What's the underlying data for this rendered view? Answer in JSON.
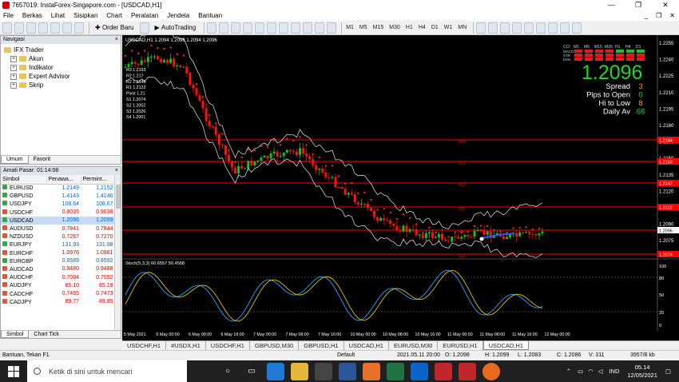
{
  "window": {
    "title": "7657019: InstaForex-Singapore.com - [USDCAD,H1]",
    "controls": [
      "—",
      "❐",
      "✕"
    ]
  },
  "menu": {
    "items": [
      "File",
      "Berkas",
      "Lihat",
      "Sisipkan",
      "Chart",
      "Peralatan",
      "Jendela",
      "Bantuan"
    ],
    "mdi": [
      "_",
      "❐",
      "✕"
    ]
  },
  "toolbar": {
    "order": "Order Baru",
    "autotrading": "AutoTrading",
    "timeframes": [
      "M1",
      "M5",
      "M15",
      "M30",
      "H1",
      "H4",
      "D1",
      "W1",
      "MN"
    ]
  },
  "navigator": {
    "title": "Navigasi",
    "root": "IFX Trader",
    "items": [
      "Akun",
      "Indikator",
      "Expert Advisor",
      "Skrip"
    ],
    "tabs": [
      "Umum",
      "Favorit"
    ]
  },
  "market": {
    "title": "Amati Pasar: 01:14:08",
    "cols": [
      "Simbol",
      "Penawa...",
      "Permint..."
    ],
    "rows": [
      {
        "s": "EURUSD",
        "b": "1.2149",
        "a": "1.2152",
        "d": "up"
      },
      {
        "s": "GBPUSD",
        "b": "1.4143",
        "a": "1.4146",
        "d": "up"
      },
      {
        "s": "USDJPY",
        "b": "108.64",
        "a": "108.67",
        "d": "up"
      },
      {
        "s": "USDCHF",
        "b": "0.9035",
        "a": "0.9038",
        "d": "dn"
      },
      {
        "s": "USDCAD",
        "b": "1.2096",
        "a": "1.2099",
        "d": "up"
      },
      {
        "s": "AUDUSD",
        "b": "0.7841",
        "a": "0.7844",
        "d": "dn"
      },
      {
        "s": "NZDUSD",
        "b": "0.7267",
        "a": "0.7270",
        "d": "dn"
      },
      {
        "s": "EURJPY",
        "b": "131.93",
        "a": "131.98",
        "d": "up"
      },
      {
        "s": "EURCHF",
        "b": "1.0976",
        "a": "1.0981",
        "d": "dn"
      },
      {
        "s": "EURGBP",
        "b": "0.8589",
        "a": "0.8592",
        "d": "up"
      },
      {
        "s": "AUDCAD",
        "b": "0.9480",
        "a": "0.9488",
        "d": "dn"
      },
      {
        "s": "AUDCHF",
        "b": "0.7084",
        "a": "0.7092",
        "d": "dn"
      },
      {
        "s": "AUDJPY",
        "b": "85.10",
        "a": "85.18",
        "d": "dn"
      },
      {
        "s": "CADCHF",
        "b": "0.7465",
        "a": "0.7473",
        "d": "dn"
      },
      {
        "s": "CADJPY",
        "b": "89.77",
        "a": "89.85",
        "d": "dn"
      }
    ],
    "tabs": [
      "Simbol",
      "Chart Tick"
    ]
  },
  "chart": {
    "header": "USDCAD,H1  1.2094 1.2096 1.2094 1.2096",
    "pivots": [
      "R3 1.2193",
      "R2 1.217",
      "R2 1.2148",
      "R1 1.2122",
      "Pivot 1.21",
      "S1 1.2074",
      "S2 1.2052",
      "S3 1.2026",
      "S4 1.2001"
    ],
    "lines": [
      "R4",
      "R3",
      "R2",
      "R1",
      "PP",
      "S1"
    ],
    "price_labels": [
      "1.2255",
      "1.2240",
      "1.2225",
      "1.2210",
      "1.2195",
      "1.2180",
      "1.2165",
      "1.2150",
      "1.2135",
      "1.2120",
      "1.2105",
      "1.2090",
      "1.2075"
    ],
    "line_prices": [
      "1.2184",
      "1.2163",
      "1.2147",
      "1.2122",
      "1.2096",
      "1.2074"
    ],
    "info": {
      "big": "1.2096",
      "rows": [
        [
          "Spread",
          "3"
        ],
        [
          "Pips to Open",
          "0"
        ],
        [
          "Hi to Low",
          "8"
        ],
        [
          "Daily Av",
          "68"
        ]
      ],
      "tf": [
        "CCI",
        "M1",
        "M5",
        "M15",
        "M30",
        "H1",
        "H4",
        "D1"
      ],
      "rowlabels": [
        "MACD",
        "STR",
        "EMA"
      ]
    },
    "stoch": {
      "label": "Stoch(5,3,3) 60.6557 50.4568",
      "levels": [
        "100",
        "80",
        "50",
        "20",
        "0"
      ]
    },
    "times": [
      "5 May 2021",
      "6 May 00:00",
      "6 May 08:00",
      "6 May 16:00",
      "7 May 00:00",
      "7 May 08:00",
      "7 May 16:00",
      "10 May 00:00",
      "10 May 08:00",
      "10 May 16:00",
      "11 May 00:00",
      "11 May 08:00",
      "11 May 16:00",
      "12 May 00:00"
    ],
    "colors": {
      "bull": "#18c018",
      "bear": "#ff1010",
      "dots": "#ff2020",
      "band": "#cfcfcf",
      "hline": "#ff0000"
    }
  },
  "chart_tabs": [
    "USDCHF,H1",
    "#USDX,H1",
    "USDCHF,H1",
    "GBPUSD,M30",
    "GBPUSD,H1",
    "USDCAD,H1",
    "EURUSD,M30",
    "EURUSD,H1",
    "USDCAD,H1"
  ],
  "status": {
    "help": "Bantuan, Tekan F1",
    "profile": "Default",
    "time": "2021.05.11 20:00",
    "o": "O: 1.2098",
    "h": "H: 1.2099",
    "l": "L: 1.2083",
    "c": "C: 1.2086",
    "v": "V: 311",
    "kb": "3957/8 kb"
  },
  "taskbar": {
    "search": "Ketik di sini untuk mencari",
    "lang": "IND",
    "time": "05.14",
    "date": "12/05/2021"
  }
}
